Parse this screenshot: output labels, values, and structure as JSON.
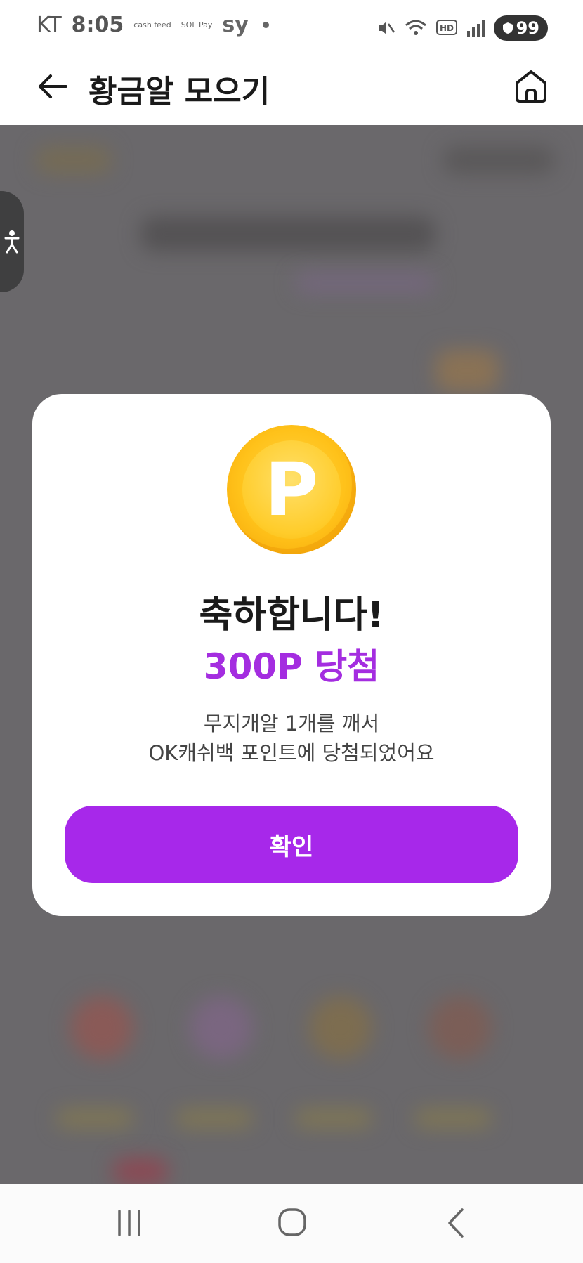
{
  "status_bar": {
    "carrier": "KT",
    "time": "8:05",
    "app1": "cash feed",
    "app2": "SOL Pay",
    "app3": "sy",
    "battery": "99"
  },
  "header": {
    "title": "황금알 모으기"
  },
  "modal": {
    "coin_letter": "P",
    "congrats": "축하합니다!",
    "prize": "300P 당첨",
    "desc_line1": "무지개알 1개를 깨서",
    "desc_line2": "OK캐쉬백 포인트에 당첨되었어요",
    "confirm_label": "확인"
  },
  "colors": {
    "accent": "#a728ea",
    "prize_text": "#a42de0",
    "coin": "#ffc21a",
    "overlay": "#6a686b"
  }
}
